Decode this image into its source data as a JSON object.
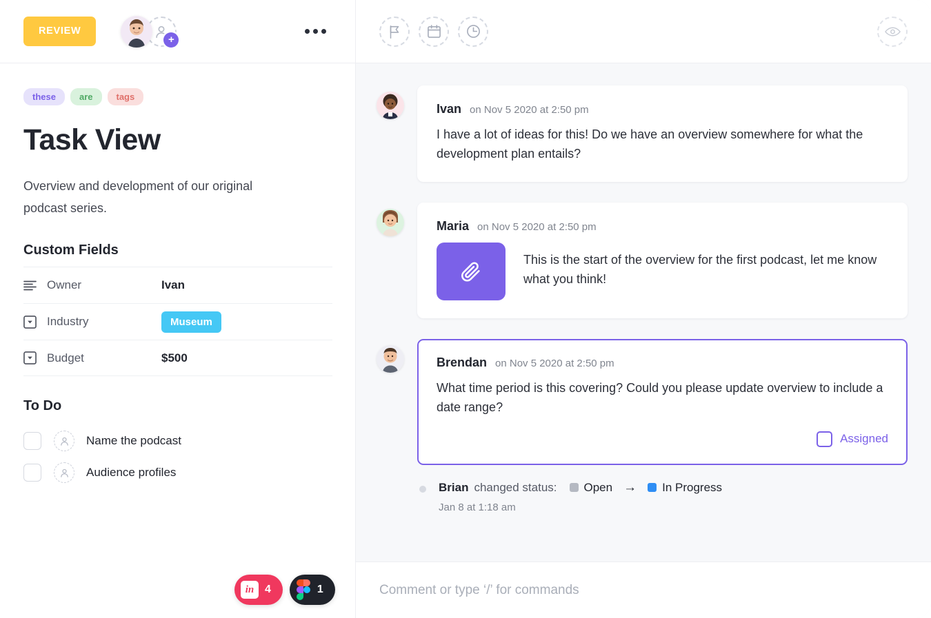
{
  "header": {
    "review_label": "REVIEW",
    "more_icon": "ellipsis-icon",
    "add_person_icon": "add-person-icon",
    "toolbar_icons": [
      {
        "name": "flag-icon",
        "label": "Priority"
      },
      {
        "name": "calendar-icon",
        "label": "Due date"
      },
      {
        "name": "clock-icon",
        "label": "Time estimate"
      }
    ],
    "watch_icon": "eye-icon"
  },
  "task": {
    "tags": [
      {
        "label": "these",
        "bg": "#e6e2fb",
        "color": "#7b61e8"
      },
      {
        "label": "are",
        "bg": "#d9f2dd",
        "color": "#4fa964"
      },
      {
        "label": "tags",
        "bg": "#fadedd",
        "color": "#e0706a"
      }
    ],
    "title": "Task View",
    "description": "Overview and development of our original podcast series."
  },
  "custom_fields": {
    "heading": "Custom Fields",
    "rows": [
      {
        "icon": "text-lines-icon",
        "label": "Owner",
        "value": "Ivan",
        "type": "text"
      },
      {
        "icon": "dropdown-box-icon",
        "label": "Industry",
        "value": "Museum",
        "type": "badge",
        "badge_color": "#45c8f5"
      },
      {
        "icon": "dropdown-box-icon",
        "label": "Budget",
        "value": "$500",
        "type": "text"
      }
    ]
  },
  "todo": {
    "heading": "To Do",
    "items": [
      {
        "label": "Name the podcast",
        "checked": false,
        "assignee_icon": "person-outline-icon"
      },
      {
        "label": "Audience profiles",
        "checked": false,
        "assignee_icon": "person-outline-icon"
      }
    ]
  },
  "integrations": [
    {
      "name": "invision",
      "logo_text": "in",
      "count": "4",
      "bg": "#f0385e"
    },
    {
      "name": "figma",
      "logo_text": "",
      "count": "1",
      "bg": "#20232b"
    }
  ],
  "comments": [
    {
      "author": "Ivan",
      "time": "on Nov 5 2020 at 2:50 pm",
      "text": "I have a lot of ideas for this! Do we have an overview somewhere for what the development plan entails?",
      "avatar_bg": "#fbe4e9",
      "highlighted": false,
      "has_attachment": false
    },
    {
      "author": "Maria",
      "time": "on Nov 5 2020 at 2:50 pm",
      "text": "This is the start of the overview for the first podcast, let me know what you think!",
      "avatar_bg": "#ddf3e0",
      "highlighted": false,
      "has_attachment": true,
      "attachment_icon": "paperclip-icon",
      "attachment_color": "#7b61e8"
    },
    {
      "author": "Brendan",
      "time": "on Nov 5 2020 at 2:50 pm",
      "text": "What time period is this covering? Could you please update overview to include a date range?",
      "avatar_bg": "#eeeef4",
      "highlighted": true,
      "has_attachment": false,
      "assigned_label": "Assigned",
      "assigned_checked": false,
      "accent": "#7b61e8"
    }
  ],
  "activity": {
    "user": "Brian",
    "action": "changed status:",
    "from_status": "Open",
    "from_color": "#b5b9c2",
    "arrow": "→",
    "to_status": "In Progress",
    "to_color": "#2f8ef4",
    "timestamp": "Jan 8 at 1:18 am"
  },
  "composer": {
    "placeholder": "Comment or type ‘/’ for commands",
    "value": ""
  }
}
